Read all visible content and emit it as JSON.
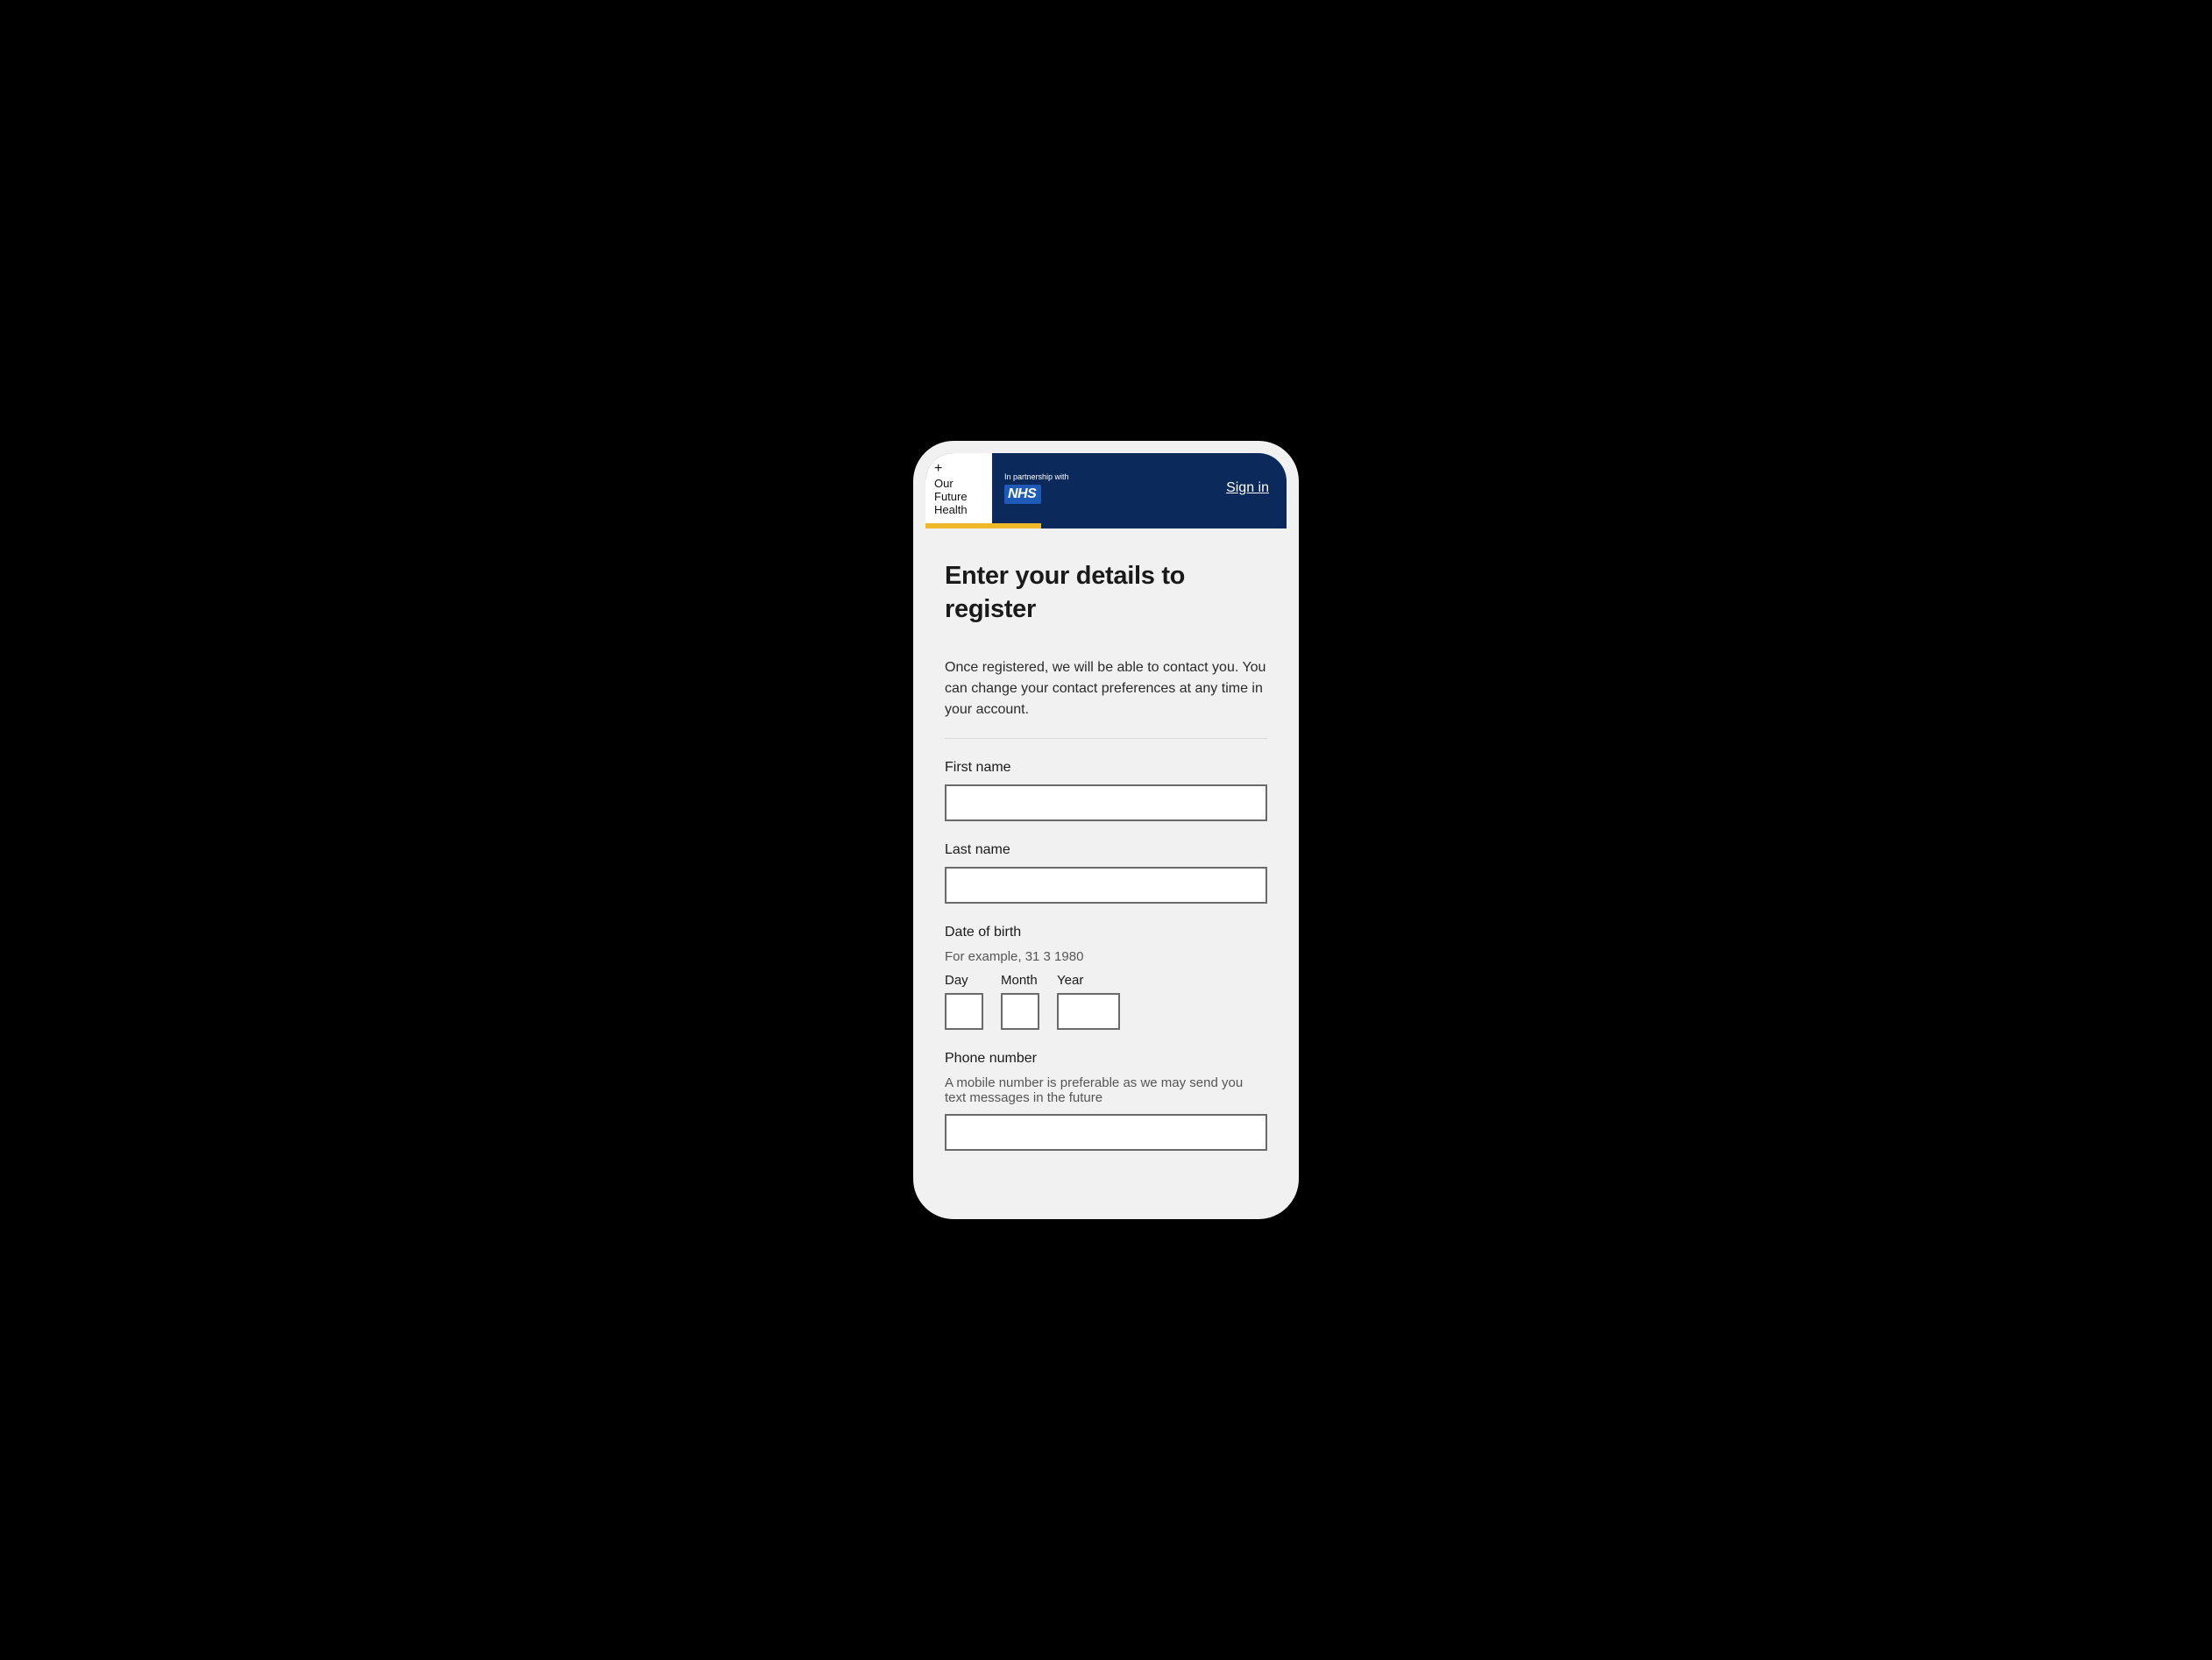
{
  "header": {
    "logo_plus": "+",
    "logo_line1": "Our",
    "logo_line2": "Future",
    "logo_line3": "Health",
    "partnership_text": "In partnership with",
    "nhs_text": "NHS",
    "signin_label": "Sign in"
  },
  "progress": {
    "percent": 32
  },
  "page": {
    "title": "Enter your details to register",
    "intro": "Once registered, we will be able to contact you. You can change your contact preferences at any time in your account."
  },
  "form": {
    "first_name": {
      "label": "First name",
      "value": ""
    },
    "last_name": {
      "label": "Last name",
      "value": ""
    },
    "dob": {
      "legend": "Date of birth",
      "hint": "For example, 31 3 1980",
      "day_label": "Day",
      "month_label": "Month",
      "year_label": "Year",
      "day_value": "",
      "month_value": "",
      "year_value": ""
    },
    "phone": {
      "label": "Phone number",
      "hint": "A mobile number is preferable as we may send you text messages in the future",
      "value": ""
    }
  }
}
